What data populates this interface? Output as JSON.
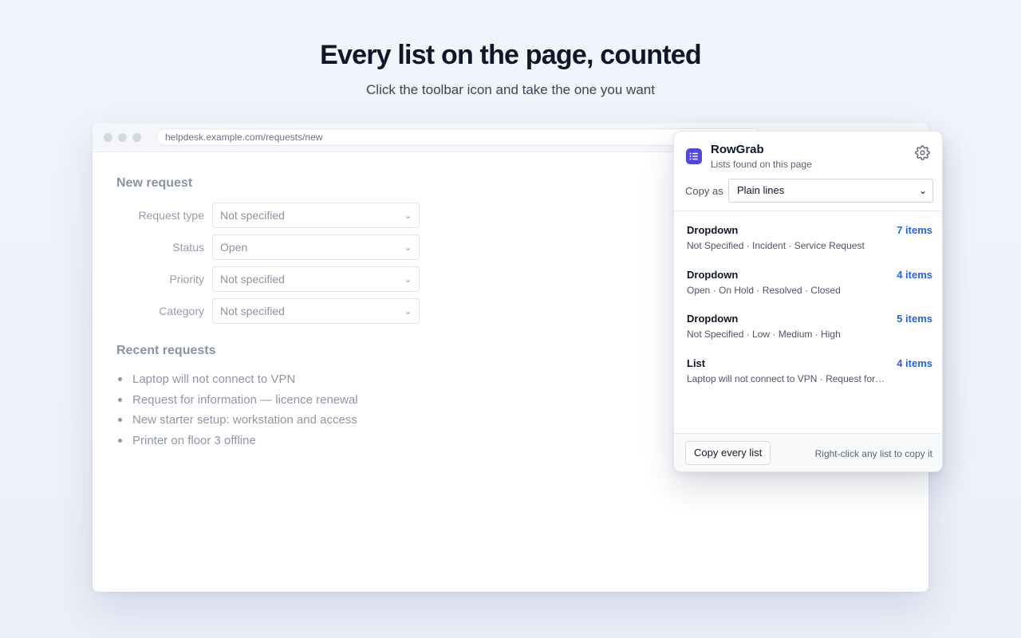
{
  "hero": {
    "title": "Every list on the page, counted",
    "subtitle": "Click the toolbar icon and take the one you want"
  },
  "browser": {
    "url": "helpdesk.example.com/requests/new"
  },
  "form": {
    "heading": "New request",
    "fields": [
      {
        "label": "Request type",
        "value": "Not specified"
      },
      {
        "label": "Status",
        "value": "Open"
      },
      {
        "label": "Priority",
        "value": "Not specified"
      },
      {
        "label": "Category",
        "value": "Not specified"
      }
    ],
    "chevron": "⌄"
  },
  "recent": {
    "heading": "Recent requests",
    "items": [
      "Laptop will not connect to VPN",
      "Request for information — licence renewal",
      "New starter setup: workstation and access",
      "Printer on floor 3 offline"
    ]
  },
  "popup": {
    "app_name": "RowGrab",
    "app_subtitle": "Lists found on this page",
    "app_icon": "list-icon",
    "settings_icon": "gear-icon",
    "copy_as_label": "Copy as",
    "copy_as_value": "Plain lines",
    "copy_as_chevron": "⌄",
    "lists": [
      {
        "kind": "Dropdown",
        "count": "7 items",
        "preview": "Not Specified · Incident · Service Request"
      },
      {
        "kind": "Dropdown",
        "count": "4 items",
        "preview": "Open · On Hold · Resolved · Closed"
      },
      {
        "kind": "Dropdown",
        "count": "5 items",
        "preview": "Not Specified · Low · Medium · High"
      },
      {
        "kind": "List",
        "count": "4 items",
        "preview": "Laptop will not connect to VPN · Request for…"
      }
    ],
    "copy_every_label": "Copy every list",
    "footer_hint": "Right-click any list to copy it"
  },
  "colors": {
    "accent": "#2563eb",
    "app_icon_bg": "#4f46e5"
  }
}
